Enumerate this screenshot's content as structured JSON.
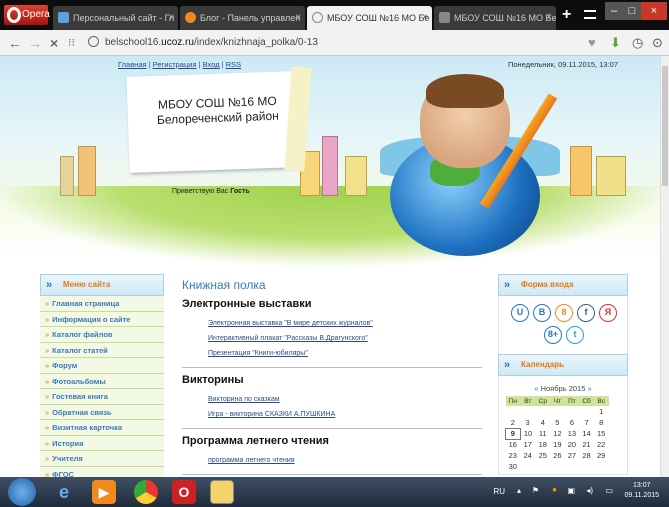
{
  "browser": {
    "opera_label": "Opera",
    "tabs": [
      {
        "title": "Персональный сайт - Гл",
        "color": "#5aa3e0"
      },
      {
        "title": "Блог - Панель управлен",
        "color": "#f08a1c"
      },
      {
        "title": "МБОУ СОШ №16 МО Бе",
        "color": "#888888"
      },
      {
        "title": "МБОУ СОШ №16 МО Бе",
        "color": "#555555"
      }
    ],
    "close_glyph": "×",
    "new_tab_glyph": "+",
    "url_prefix": "belschool16.",
    "url_domain": "ucoz.ru",
    "url_path": "/index/knizhnaja_polka/0-13"
  },
  "header": {
    "links": [
      "Главная",
      "Регистрация",
      "Вход",
      "RSS"
    ],
    "date": "Понедельник, 09.11.2015, 13:07",
    "school_line1": "МБОУ СОШ №16 МО",
    "school_line2": "Белореченский район",
    "greet_text": "Приветствую Вас",
    "greet_user": "Гость"
  },
  "left_menu": {
    "title": "Меню сайта",
    "items": [
      "Главная страница",
      "Информация о сайте",
      "Каталог файлов",
      "Каталог статей",
      "Форум",
      "Фотоальбомы",
      "Гостевая книга",
      "Обратная связь",
      "Визитная карточка",
      "История",
      "Учителя",
      "ФГОС"
    ]
  },
  "main": {
    "page_title": "Книжная полка",
    "sections": [
      {
        "title": "Электронные выставки",
        "links": [
          "Электронная выставка \"В мире детских журналов\"",
          "Интерактивный плакат \"Рассказы В.Драгунского\"",
          "Презентация \"Книги-юбиляры\""
        ]
      },
      {
        "title": "Викторины",
        "links": [
          "Викторина по сказкам",
          "Игра - викторина СКАЗКИ А.ПУШКИНА"
        ]
      },
      {
        "title": "Программа летнего чтения",
        "links": [
          "программа летнего чтения"
        ]
      }
    ]
  },
  "login": {
    "title": "Форма входа",
    "social": [
      {
        "glyph": "U",
        "color": "#2a74c9"
      },
      {
        "glyph": "B",
        "color": "#2a74c9"
      },
      {
        "glyph": "8",
        "color": "#f08a1c"
      },
      {
        "glyph": "f",
        "color": "#3b5998"
      },
      {
        "glyph": "Я",
        "color": "#e03030"
      },
      {
        "glyph": "8+",
        "color": "#2a74c9"
      },
      {
        "glyph": "t",
        "color": "#2aa0e0"
      }
    ]
  },
  "calendar": {
    "title": "Календарь",
    "prev": "«",
    "month": "Ноябрь 2015",
    "next": "»",
    "weekdays": [
      "Пн",
      "Вт",
      "Ср",
      "Чт",
      "Пт",
      "Сб",
      "Вс"
    ],
    "rows": [
      [
        "",
        "",
        "",
        "",
        "",
        "",
        "1"
      ],
      [
        "2",
        "3",
        "4",
        "5",
        "6",
        "7",
        "8"
      ],
      [
        "9",
        "10",
        "11",
        "12",
        "13",
        "14",
        "15"
      ],
      [
        "16",
        "17",
        "18",
        "19",
        "20",
        "21",
        "22"
      ],
      [
        "23",
        "24",
        "25",
        "26",
        "27",
        "28",
        "29"
      ],
      [
        "30",
        "",
        "",
        "",
        "",
        "",
        ""
      ]
    ],
    "today": "9"
  },
  "taskbar": {
    "lang": "RU",
    "time": "13:07",
    "date": "09.11.2015"
  }
}
